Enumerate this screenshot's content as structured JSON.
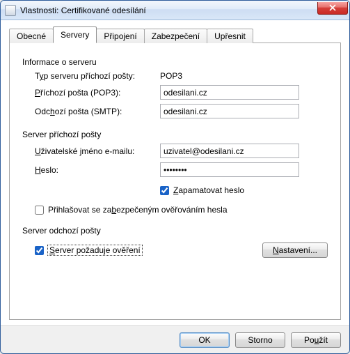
{
  "window": {
    "title": "Vlastnosti: Certifikované odesílání"
  },
  "tabs": {
    "general": "Obecné",
    "servers": "Servery",
    "connection": "Připojení",
    "security": "Zabezpečení",
    "advanced": "Upřesnit"
  },
  "serverInfo": {
    "legend": "Informace o serveru",
    "typeLabelPre": "T",
    "typeLabelU": "y",
    "typeLabelPost": "p serveru příchozí pošty:",
    "typeValue": "POP3",
    "incomingLabelU": "P",
    "incomingLabelPost": "říchozí pošta (POP3):",
    "incomingValue": "odesilani.cz",
    "outgoingLabelPre": "Odc",
    "outgoingLabelU": "h",
    "outgoingLabelPost": "ozí pošta (SMTP):",
    "outgoingValue": "odesilani.cz"
  },
  "incomingServer": {
    "legend": "Server příchozí pošty",
    "userLabelU": "U",
    "userLabelPost": "živatelské jméno e-mailu:",
    "userValue": "uzivatel@odesilani.cz",
    "passLabelU": "H",
    "passLabelPost": "eslo:",
    "passValue": "••••••••",
    "rememberU": "Z",
    "rememberPost": "apamatovat heslo",
    "rememberChecked": true,
    "spaPre": "Přihlašovat se za",
    "spaU": "b",
    "spaPost": "ezpečeným ověřováním hesla",
    "spaChecked": false
  },
  "outgoingServer": {
    "legend": "Server odchozí pošty",
    "authU": "S",
    "authPost": "erver požaduje ověření",
    "authChecked": true,
    "settingsU": "N",
    "settingsPost": "astavení..."
  },
  "buttons": {
    "ok": "OK",
    "cancel": "Storno",
    "applyPre": "Po",
    "applyU": "u",
    "applyPost": "žít"
  }
}
